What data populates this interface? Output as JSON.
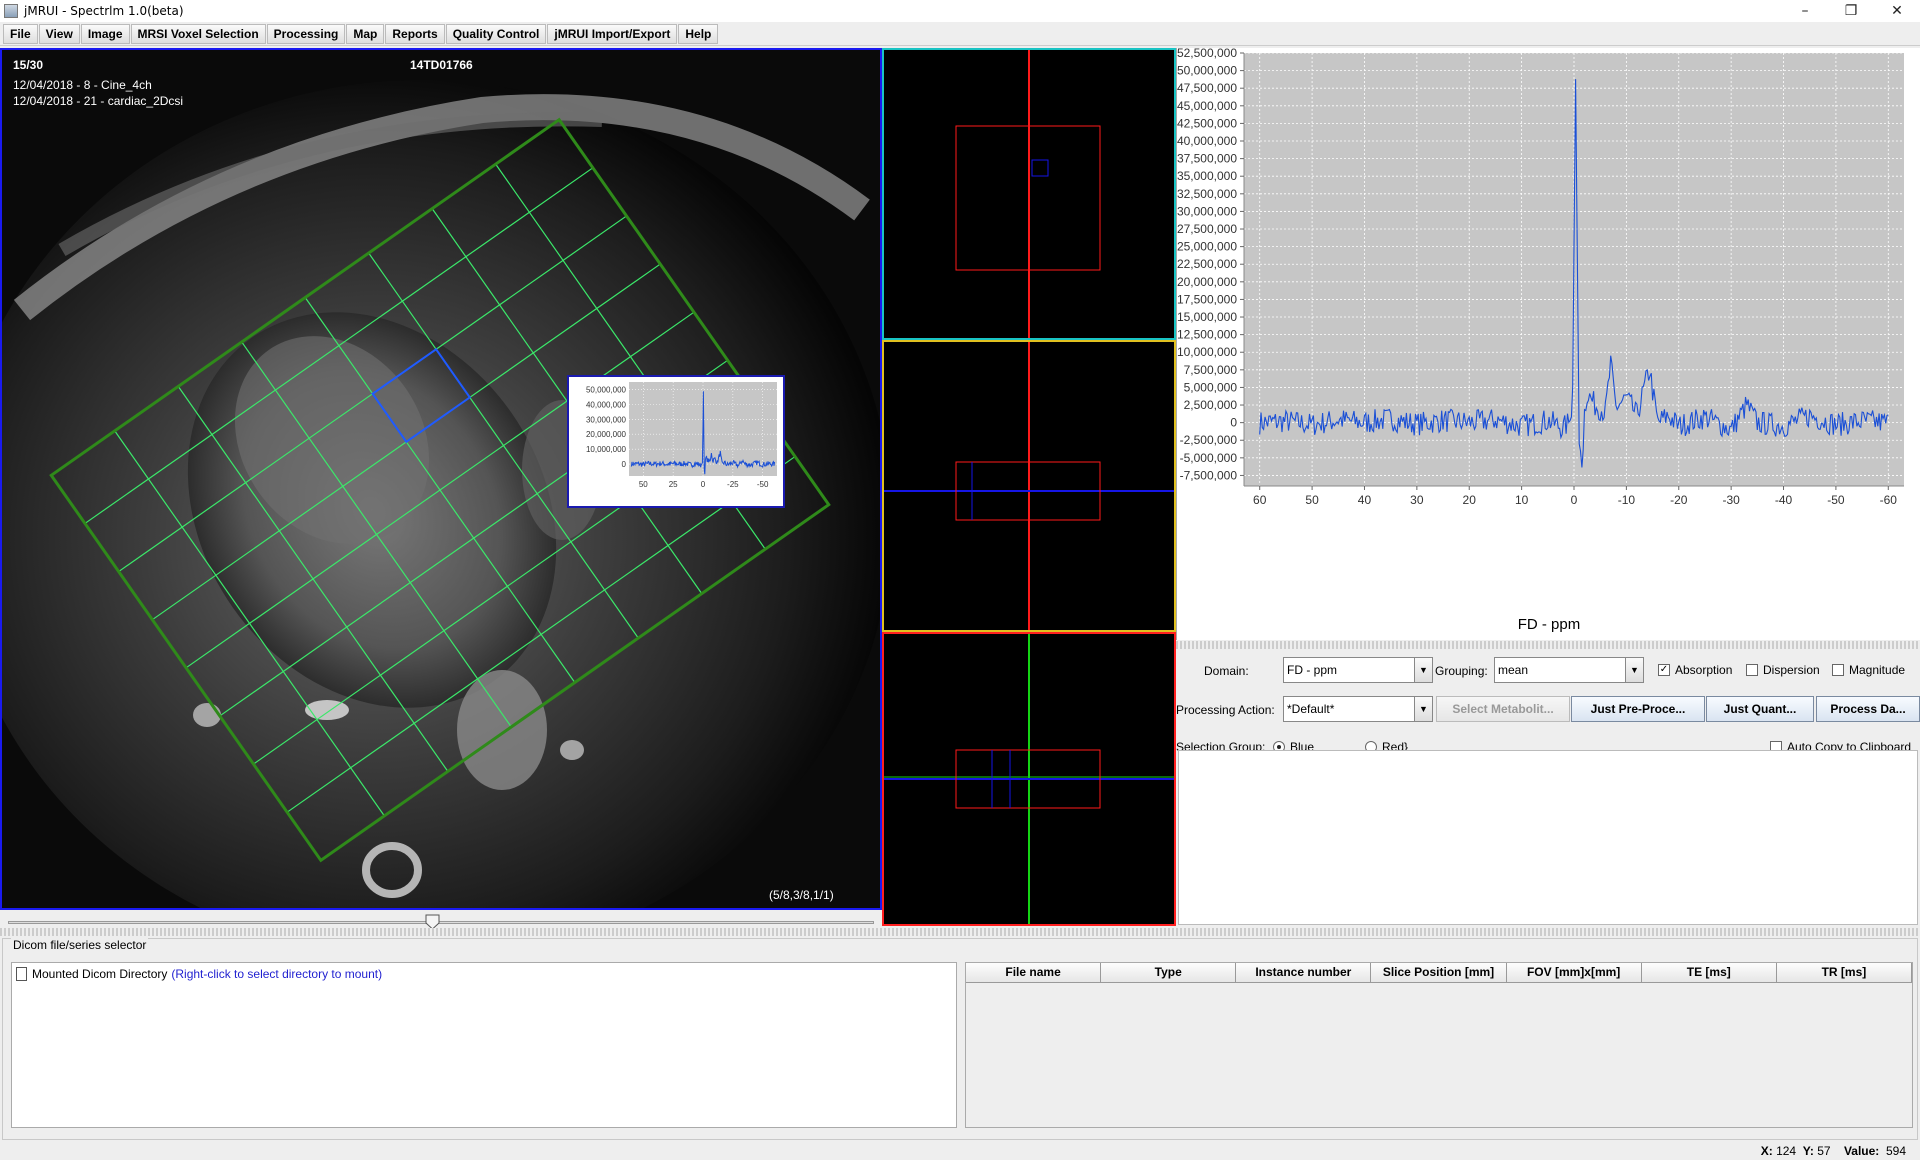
{
  "window": {
    "title": "jMRUI - Spectrlm 1.0(beta)",
    "controls": [
      "–",
      "❐",
      "✕"
    ]
  },
  "menu": [
    "File",
    "View",
    "Image",
    "MRSI Voxel Selection",
    "Processing",
    "Map",
    "Reports",
    "Quality Control",
    "jMRUI Import/Export",
    "Help"
  ],
  "viewer": {
    "slice": "15/30",
    "patient_id": "14TD01766",
    "series_1": "12/04/2018 - 8 - Cine_4ch",
    "series_2": "12/04/2018 - 21 - cardiac_2Dcsi",
    "voxel_index": "(5/8,3/8,1/1)",
    "slider_fraction": 0.49
  },
  "inset_chart": {
    "yticks": [
      "50,000,000",
      "40,000,000",
      "30,000,000",
      "20,000,000",
      "10,000,000",
      "0"
    ],
    "xticks": [
      "50",
      "25",
      "0",
      "-25",
      "-50"
    ]
  },
  "chart_data": {
    "type": "line",
    "title": "",
    "xlabel": "FD - ppm",
    "ylabel": "",
    "xlim": [
      63,
      -63
    ],
    "ylim": [
      -9000000,
      52500000
    ],
    "x_ticks": [
      "60",
      "50",
      "40",
      "30",
      "20",
      "10",
      "0",
      "-10",
      "-20",
      "-30",
      "-40",
      "-50",
      "-60"
    ],
    "y_ticks": [
      "52,500,000",
      "50,000,000",
      "47,500,000",
      "45,000,000",
      "42,500,000",
      "40,000,000",
      "37,500,000",
      "35,000,000",
      "32,500,000",
      "30,000,000",
      "27,500,000",
      "25,000,000",
      "22,500,000",
      "20,000,000",
      "17,500,000",
      "15,000,000",
      "12,500,000",
      "10,000,000",
      "7,500,000",
      "5,000,000",
      "2,500,000",
      "0",
      "-2,500,000",
      "-5,000,000",
      "-7,500,000"
    ],
    "series": [
      {
        "color": "#1a4fd6",
        "x": [
          60,
          55,
          50,
          45,
          40,
          35,
          30,
          25,
          20,
          15,
          10,
          5,
          2,
          0.8,
          0.3,
          -0.3,
          -1,
          -1.6,
          -2,
          -2.5,
          -4,
          -6,
          -7,
          -8,
          -10,
          -12,
          -14,
          -14.5,
          -15,
          -16,
          -18,
          -20,
          -25,
          -30,
          -33,
          -35,
          -40,
          -45,
          -50,
          -55,
          -60
        ],
        "y": [
          0,
          200000,
          -300000,
          400000,
          0,
          500000,
          -200000,
          300000,
          0,
          400000,
          -500000,
          300000,
          -800000,
          200000,
          1200000,
          48800000,
          -3000000,
          -5500000,
          1500000,
          4200000,
          2500000,
          1500000,
          8300000,
          2200000,
          3500000,
          1000000,
          6500000,
          7500000,
          4500000,
          0,
          1000000,
          -500000,
          800000,
          -1000000,
          2500000,
          0,
          -500000,
          1000000,
          -300000,
          200000,
          0
        ]
      }
    ],
    "grid": true,
    "legend": "none",
    "plot_background": "#c6c6c6"
  },
  "controls": {
    "domain_label": "Domain:",
    "domain_value": "FD - ppm",
    "grouping_label": "Grouping:",
    "grouping_value": "mean",
    "absorption": "Absorption",
    "dispersion": "Dispersion",
    "magnitude": "Magnitude",
    "processing_label": "Processing Action:",
    "processing_value": "*Default*",
    "select_metabolite": "Select Metabolit...",
    "just_preprocess": "Just Pre-Proce...",
    "just_quant": "Just Quant...",
    "process_data": "Process Da...",
    "selection_group_label": "Selection Group:",
    "group_blue": "Blue",
    "group_red": "Red",
    "auto_copy": "Auto Copy to Clipboard"
  },
  "dicom": {
    "panel_title": "Dicom file/series selector",
    "tree_root": "Mounted Dicom Directory",
    "tree_hint": "(Right-click to select directory to mount)",
    "columns": [
      "File name",
      "Type",
      "Instance number",
      "Slice Position [mm]",
      "FOV [mm]x[mm]",
      "TE [ms]",
      "TR [ms]"
    ]
  },
  "status": {
    "x_label": "X:",
    "x": "124",
    "y_label": "Y:",
    "y": "57",
    "value_label": "Value:",
    "value": "594"
  },
  "colors": {
    "viewer_border": "#1a1af0",
    "grid_outer": "#2f8a1a",
    "grid_inner": "#3be86a",
    "selected_voxel": "#1f5bff",
    "ortho_red": "#ff1a1a",
    "ortho_blue": "#1515e6",
    "ortho_green": "#14d414",
    "spectrum_line": "#1a4fd6"
  }
}
